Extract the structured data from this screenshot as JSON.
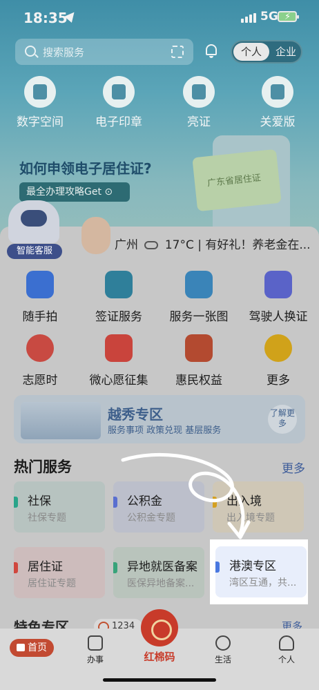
{
  "status": {
    "time": "18:35",
    "network": "5G"
  },
  "header": {
    "search_placeholder": "搜索服务",
    "toggle": {
      "personal": "个人",
      "business": "企业"
    },
    "quick_actions": [
      {
        "label": "数字空间",
        "icon": "digital-space-icon"
      },
      {
        "label": "电子印章",
        "icon": "seal-icon"
      },
      {
        "label": "亮证",
        "icon": "id-card-icon"
      },
      {
        "label": "关爱版",
        "icon": "care-icon"
      }
    ]
  },
  "banner": {
    "title": "如何申领电子居住证?",
    "button": "最全办理攻略Get ⊙",
    "card_text": "广东省居住证"
  },
  "assistant": {
    "label": "智能客服"
  },
  "weather": {
    "city": "广州",
    "temp": "17°C",
    "notice": "| 有好礼！养老金在..."
  },
  "services": [
    {
      "label": "随手拍",
      "color": "#3b6fd0"
    },
    {
      "label": "签证服务",
      "color": "#2f7f9a"
    },
    {
      "label": "服务一张图",
      "color": "#3a84b8"
    },
    {
      "label": "驾驶人换证",
      "color": "#5a63c8"
    },
    {
      "label": "志愿时",
      "color": "#c84a42"
    },
    {
      "label": "微心愿征集",
      "color": "#c9443c"
    },
    {
      "label": "惠民权益",
      "color": "#b34a30"
    },
    {
      "label": "更多",
      "color": "#d0a21a"
    }
  ],
  "district": {
    "title": "越秀专区",
    "subtitle": "服务事项  政策兑现  基层服务",
    "more": "了解更多"
  },
  "hot_services": {
    "title": "热门服务",
    "more": "更多",
    "items": [
      {
        "title": "社保",
        "subtitle": "社保专题",
        "bg": "#b7c3c0",
        "bar": "#2aa48a"
      },
      {
        "title": "公积金",
        "subtitle": "公积金专题",
        "bg": "#bcbfcb",
        "bar": "#5a6fd0"
      },
      {
        "title": "出入境",
        "subtitle": "出入境专题",
        "bg": "#cfc7b6",
        "bar": "#d4a020"
      },
      {
        "title": "居住证",
        "subtitle": "居住证专题",
        "bg": "#cdbcbc",
        "bar": "#d0473e"
      },
      {
        "title": "异地就医备案",
        "subtitle": "医保异地备案...",
        "bg": "#b9c4bc",
        "bar": "#38a37a"
      },
      {
        "title": "港澳专区",
        "subtitle": "湾区互通，共...",
        "bg": "#e8eefb",
        "bar": "#4a78e0"
      }
    ]
  },
  "featured": {
    "title": "特色专区",
    "pill": "1234",
    "more": "更多"
  },
  "tabbar": {
    "home": "首页",
    "tasks": "办事",
    "center": "红棉码",
    "life": "生活",
    "profile": "个人"
  }
}
